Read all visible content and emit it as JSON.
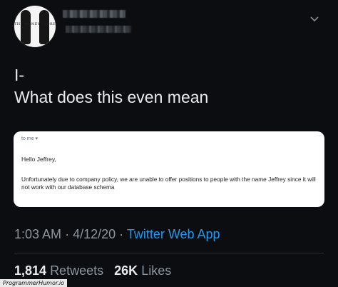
{
  "tweet": {
    "author": {
      "avatar_text": "THE MONEY STORE"
    },
    "lines": [
      "I-",
      "What does this even mean"
    ],
    "metadata": {
      "time": "1:03 AM",
      "date": "4/12/20",
      "separator": "·",
      "source": "Twitter Web App"
    },
    "stats": {
      "retweets_count": "1,814",
      "retweets_label": "Retweets",
      "likes_count": "26K",
      "likes_label": "Likes"
    }
  },
  "email": {
    "recipient_label": "to me",
    "greeting": "Hello Jeffrey,",
    "body": "Unfortunately due to company policy, we are unable to offer positions to people with the name Jeffrey since it will not work with our database schema"
  },
  "watermark": "ProgrammerHumor.io",
  "colors": {
    "background": "#0b0d10",
    "text": "#e8ecef",
    "muted": "#8b96a0",
    "accent": "#1d9bf0"
  },
  "icons": {
    "menu": "chevron-down-icon",
    "recipient_dropdown": "caret-down-icon"
  }
}
